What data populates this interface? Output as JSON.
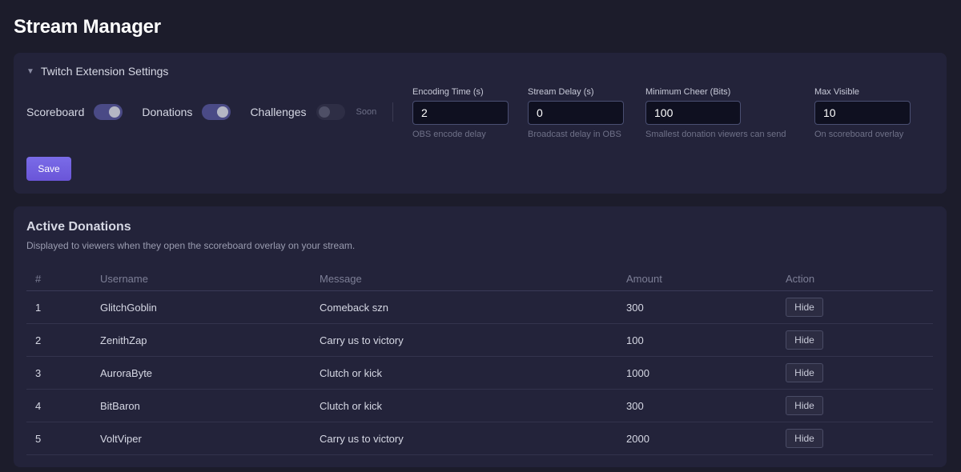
{
  "page": {
    "title": "Stream Manager"
  },
  "settings": {
    "header": "Twitch Extension Settings",
    "toggles": [
      {
        "label": "Scoreboard",
        "on": true
      },
      {
        "label": "Donations",
        "on": true
      },
      {
        "label": "Challenges",
        "on": false,
        "badge": "Soon"
      }
    ],
    "fields": [
      {
        "label": "Encoding Time (s)",
        "value": "2",
        "hint": "OBS encode delay"
      },
      {
        "label": "Stream Delay (s)",
        "value": "0",
        "hint": "Broadcast delay in OBS"
      },
      {
        "label": "Minimum Cheer (Bits)",
        "value": "100",
        "hint": "Smallest donation viewers can send"
      },
      {
        "label": "Max Visible",
        "value": "10",
        "hint": "On scoreboard overlay"
      }
    ],
    "save_label": "Save"
  },
  "donations": {
    "title": "Active Donations",
    "subtitle": "Displayed to viewers when they open the scoreboard overlay on your stream.",
    "columns": [
      "#",
      "Username",
      "Message",
      "Amount",
      "Action"
    ],
    "rows": [
      {
        "num": "1",
        "username": "GlitchGoblin",
        "message": "Comeback szn",
        "amount": "300",
        "action": "Hide"
      },
      {
        "num": "2",
        "username": "ZenithZap",
        "message": "Carry us to victory",
        "amount": "100",
        "action": "Hide"
      },
      {
        "num": "3",
        "username": "AuroraByte",
        "message": "Clutch or kick",
        "amount": "1000",
        "action": "Hide"
      },
      {
        "num": "4",
        "username": "BitBaron",
        "message": "Clutch or kick",
        "amount": "300",
        "action": "Hide"
      },
      {
        "num": "5",
        "username": "VoltViper",
        "message": "Carry us to victory",
        "amount": "2000",
        "action": "Hide"
      }
    ]
  },
  "colors": {
    "background": "#1c1c2b",
    "panel": "#23233a",
    "accent": "#6f5ee0",
    "toggle_on": "#4a4a86"
  }
}
